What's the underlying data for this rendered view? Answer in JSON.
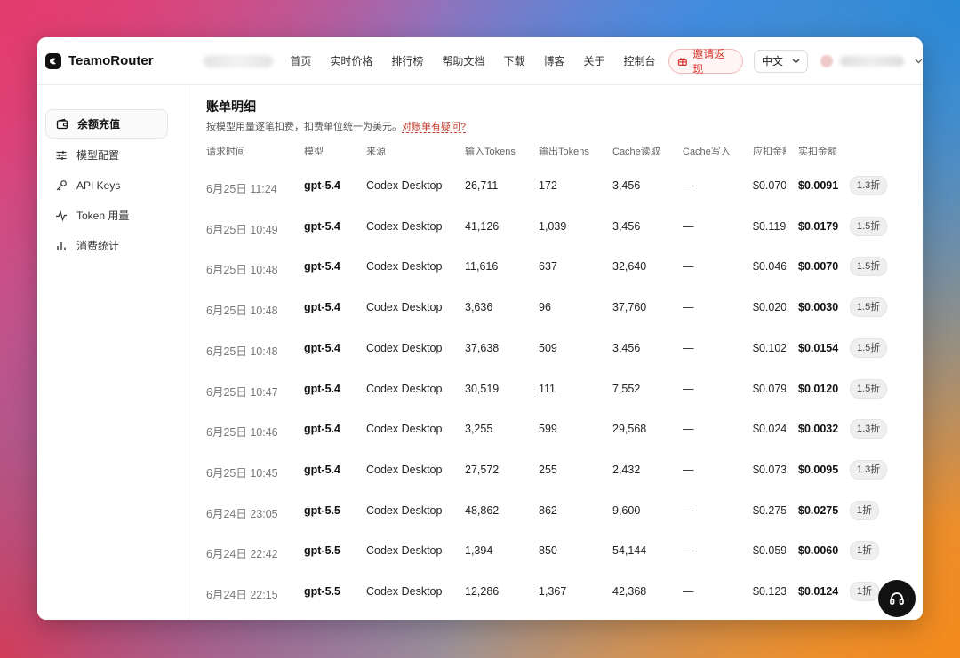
{
  "brand": {
    "name": "TeamoRouter"
  },
  "nav": {
    "items": [
      "首页",
      "实时价格",
      "排行榜",
      "帮助文档",
      "下载",
      "博客",
      "关于",
      "控制台"
    ],
    "invite_label": "邀请返现",
    "lang": "中文"
  },
  "sidebar": {
    "items": [
      {
        "label": "余额充值",
        "icon": "wallet-icon",
        "active": true
      },
      {
        "label": "模型配置",
        "icon": "sliders-icon",
        "active": false
      },
      {
        "label": "API Keys",
        "icon": "key-icon",
        "active": false
      },
      {
        "label": "Token 用量",
        "icon": "activity-icon",
        "active": false
      },
      {
        "label": "消费统计",
        "icon": "bar-chart-icon",
        "active": false
      }
    ]
  },
  "page": {
    "title": "账单明细",
    "subtitle": "按模型用量逐笔扣费，扣费单位统一为美元。",
    "help_link": "对账单有疑问?"
  },
  "table": {
    "headers": [
      "请求时间",
      "模型",
      "来源",
      "输入Tokens",
      "输出Tokens",
      "Cache读取",
      "Cache写入",
      "应扣金额",
      "实扣金额"
    ],
    "rows": [
      {
        "time": "6月25日 11:24",
        "model": "gpt-5.4",
        "source": "Codex Desktop",
        "input": "26,711",
        "output": "172",
        "cache_read": "3,456",
        "cache_write": "—",
        "due": "$0.070",
        "charged": "$0.0091",
        "discount": "1.3折"
      },
      {
        "time": "6月25日 10:49",
        "model": "gpt-5.4",
        "source": "Codex Desktop",
        "input": "41,126",
        "output": "1,039",
        "cache_read": "3,456",
        "cache_write": "—",
        "due": "$0.119",
        "charged": "$0.0179",
        "discount": "1.5折"
      },
      {
        "time": "6月25日 10:48",
        "model": "gpt-5.4",
        "source": "Codex Desktop",
        "input": "11,616",
        "output": "637",
        "cache_read": "32,640",
        "cache_write": "—",
        "due": "$0.046",
        "charged": "$0.0070",
        "discount": "1.5折"
      },
      {
        "time": "6月25日 10:48",
        "model": "gpt-5.4",
        "source": "Codex Desktop",
        "input": "3,636",
        "output": "96",
        "cache_read": "37,760",
        "cache_write": "—",
        "due": "$0.020",
        "charged": "$0.0030",
        "discount": "1.5折"
      },
      {
        "time": "6月25日 10:48",
        "model": "gpt-5.4",
        "source": "Codex Desktop",
        "input": "37,638",
        "output": "509",
        "cache_read": "3,456",
        "cache_write": "—",
        "due": "$0.102",
        "charged": "$0.0154",
        "discount": "1.5折"
      },
      {
        "time": "6月25日 10:47",
        "model": "gpt-5.4",
        "source": "Codex Desktop",
        "input": "30,519",
        "output": "111",
        "cache_read": "7,552",
        "cache_write": "—",
        "due": "$0.079",
        "charged": "$0.0120",
        "discount": "1.5折"
      },
      {
        "time": "6月25日 10:46",
        "model": "gpt-5.4",
        "source": "Codex Desktop",
        "input": "3,255",
        "output": "599",
        "cache_read": "29,568",
        "cache_write": "—",
        "due": "$0.024",
        "charged": "$0.0032",
        "discount": "1.3折"
      },
      {
        "time": "6月25日 10:45",
        "model": "gpt-5.4",
        "source": "Codex Desktop",
        "input": "27,572",
        "output": "255",
        "cache_read": "2,432",
        "cache_write": "—",
        "due": "$0.073",
        "charged": "$0.0095",
        "discount": "1.3折"
      },
      {
        "time": "6月24日 23:05",
        "model": "gpt-5.5",
        "source": "Codex Desktop",
        "input": "48,862",
        "output": "862",
        "cache_read": "9,600",
        "cache_write": "—",
        "due": "$0.275",
        "charged": "$0.0275",
        "discount": "1折"
      },
      {
        "time": "6月24日 22:42",
        "model": "gpt-5.5",
        "source": "Codex Desktop",
        "input": "1,394",
        "output": "850",
        "cache_read": "54,144",
        "cache_write": "—",
        "due": "$0.059",
        "charged": "$0.0060",
        "discount": "1折"
      },
      {
        "time": "6月24日 22:15",
        "model": "gpt-5.5",
        "source": "Codex Desktop",
        "input": "12,286",
        "output": "1,367",
        "cache_read": "42,368",
        "cache_write": "—",
        "due": "$0.123",
        "charged": "$0.0124",
        "discount": "1折"
      }
    ]
  },
  "support": {
    "icon": "headset-icon"
  },
  "colors": {
    "accent": "#c0392b",
    "invite_text": "#d6322a",
    "text": "#222222"
  }
}
